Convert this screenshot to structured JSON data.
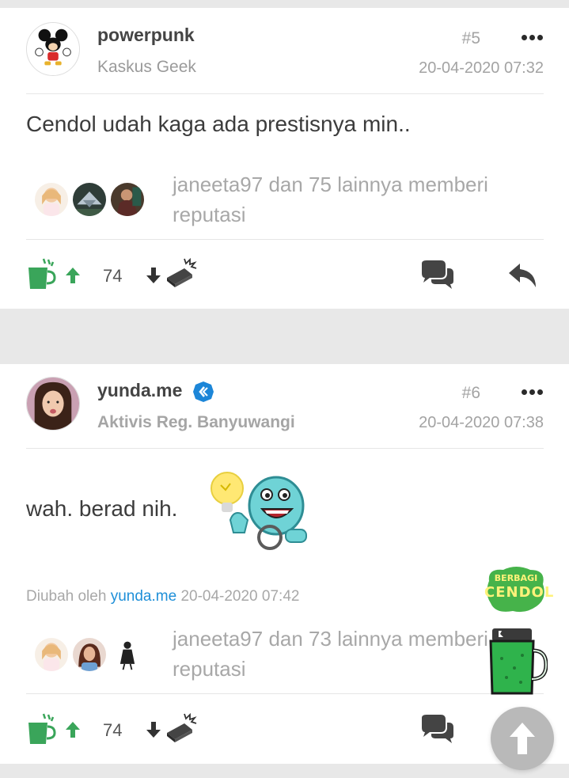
{
  "posts": [
    {
      "username": "powerpunk",
      "rank": "Kaskus Geek",
      "number": "#5",
      "timestamp": "20-04-2020 07:32",
      "content": "Cendol udah kaga ada prestisnya min..",
      "reputation_text": "janeeta97 dan 75 lainnya memberi reputasi",
      "vote_count": "74"
    },
    {
      "username": "yunda.me",
      "rank": "Aktivis Reg. Banyuwangi",
      "number": "#6",
      "timestamp": "20-04-2020 07:38",
      "content": "wah. berad nih.",
      "edited_prefix": "Diubah oleh",
      "edited_user": "yunda.me",
      "edited_time": "20-04-2020 07:42",
      "reputation_text": "janeeta97 dan 73 lainnya memberi reputasi",
      "vote_count": "74"
    }
  ],
  "promo": {
    "label_top": "BERBAGI",
    "label_bottom": "CENDOL"
  },
  "colors": {
    "accent_green": "#3aa55a",
    "link_blue": "#1e8fd8",
    "badge_blue": "#1c86d8"
  },
  "icons": [
    "cendol-up-icon",
    "arrow-up-icon",
    "arrow-down-icon",
    "bata-icon",
    "comment-icon",
    "reply-icon",
    "more-icon",
    "verified-icon",
    "scroll-top-icon"
  ]
}
